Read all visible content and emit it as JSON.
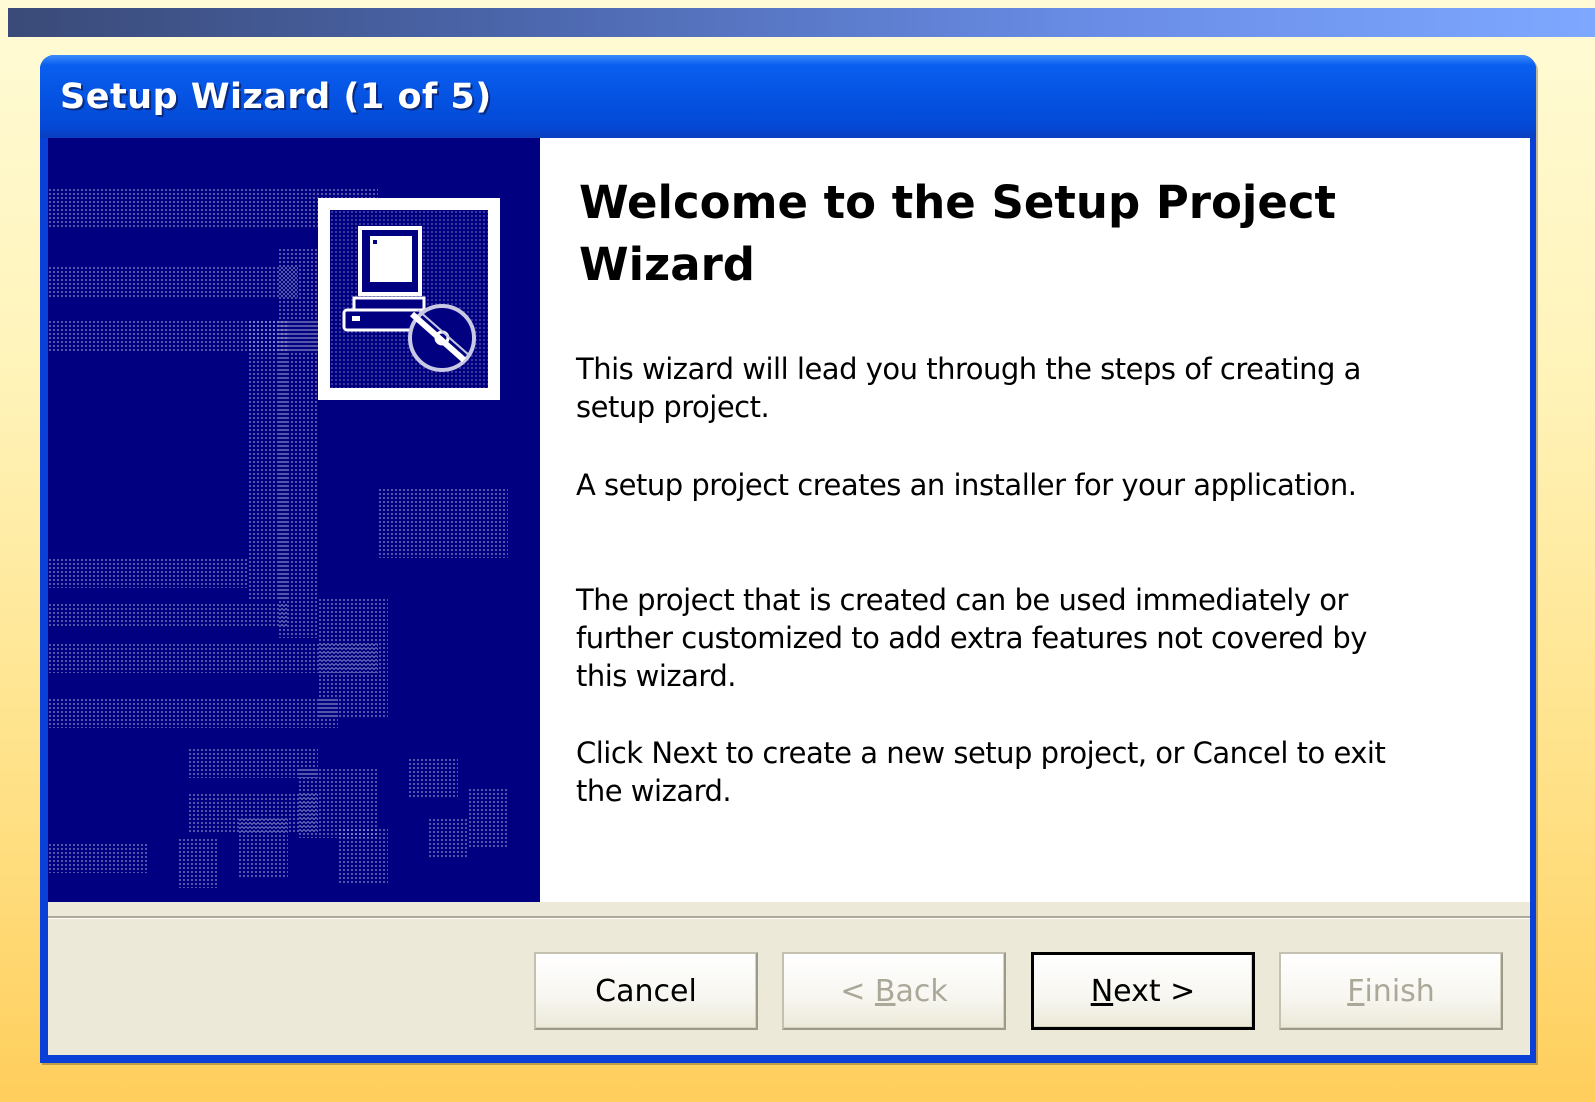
{
  "window": {
    "title": "Setup Wizard (1 of 5)"
  },
  "content": {
    "heading": "Welcome to the Setup Project Wizard",
    "paragraphs": [
      "This wizard will lead you through the steps of creating a setup project.",
      "A setup project creates an installer for your application.",
      "The project that is created can be used immediately or further customized to add extra features not covered by this wizard.",
      "Click Next to create a new setup project, or Cancel to exit the wizard."
    ]
  },
  "buttons": {
    "cancel": {
      "label": "Cancel",
      "enabled": true
    },
    "back": {
      "prefix": "< ",
      "mnemonic": "B",
      "rest": "ack",
      "enabled": false
    },
    "next": {
      "mnemonic": "N",
      "rest": "ext >",
      "enabled": true
    },
    "finish": {
      "mnemonic": "F",
      "rest": "inish",
      "enabled": false
    }
  },
  "icons": {
    "wizard_art": "computer-with-cd-icon"
  },
  "colors": {
    "titlebar": "#0553e2",
    "side_panel": "#000080",
    "dialog_face": "#ece9d8",
    "disabled_text": "#aca899"
  }
}
